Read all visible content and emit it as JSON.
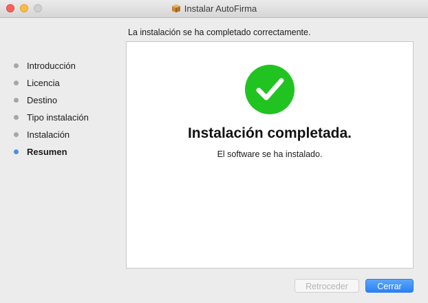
{
  "window": {
    "title": "Instalar AutoFirma",
    "title_icon": "package-icon"
  },
  "header": {
    "message": "La instalación se ha completado correctamente."
  },
  "sidebar": {
    "steps": [
      {
        "label": "Introducción",
        "active": false
      },
      {
        "label": "Licencia",
        "active": false
      },
      {
        "label": "Destino",
        "active": false
      },
      {
        "label": "Tipo instalación",
        "active": false
      },
      {
        "label": "Instalación",
        "active": false
      },
      {
        "label": "Resumen",
        "active": true
      }
    ]
  },
  "main": {
    "icon": "checkmark-icon",
    "title": "Instalación completada.",
    "subtitle": "El software se ha instalado."
  },
  "footer": {
    "back_label": "Retroceder",
    "back_enabled": false,
    "close_label": "Cerrar"
  },
  "colors": {
    "success_green": "#21c321",
    "accent_blue": "#2a82f5",
    "active_step_dot": "#4a90e2",
    "inactive_step_dot": "#a6a6a6"
  }
}
